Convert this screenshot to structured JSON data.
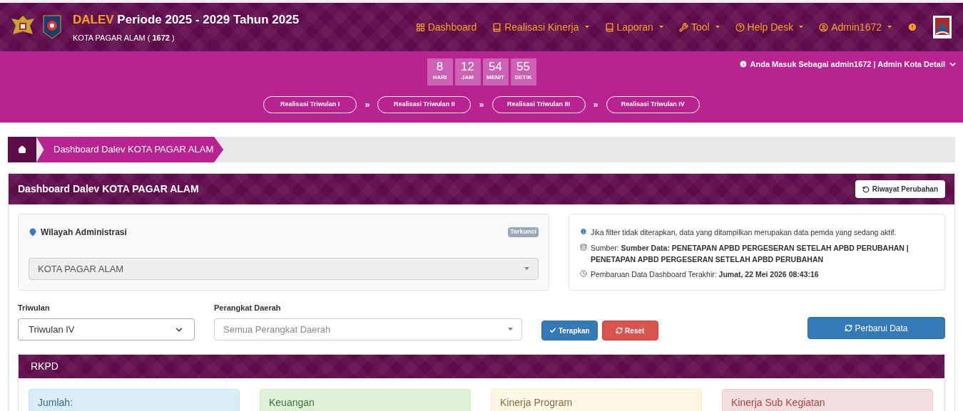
{
  "header": {
    "brand": "DALEV",
    "title": "Periode 2025 - 2029 Tahun 2025",
    "subtitle_name": "KOTA PAGAR ALAM (",
    "subtitle_code": "1672",
    "subtitle_end": ")"
  },
  "nav": [
    {
      "label": "Dashboard",
      "dropdown": false
    },
    {
      "label": "Realisasi Kinerja",
      "dropdown": true
    },
    {
      "label": "Laporan",
      "dropdown": true
    },
    {
      "label": "Tool",
      "dropdown": true
    },
    {
      "label": "Help Desk",
      "dropdown": true
    },
    {
      "label": "Admin1672",
      "dropdown": true
    }
  ],
  "countdown": [
    {
      "value": "8",
      "unit": "HARI"
    },
    {
      "value": "12",
      "unit": "JAM"
    },
    {
      "value": "54",
      "unit": "MENIT"
    },
    {
      "value": "55",
      "unit": "DETIK"
    }
  ],
  "steps": [
    {
      "label": "Realisasi Triwulan I"
    },
    {
      "label": "Realisasi Triwulan II"
    },
    {
      "label": "Realisasi Triwulan III"
    },
    {
      "label": "Realisasi Triwulan IV"
    }
  ],
  "step_separator": "»",
  "user_info": "Anda Masuk Sebagai admin1672 | Admin Kota Detail",
  "breadcrumb": "Dashboard Dalev KOTA PAGAR ALAM",
  "panel": {
    "title": "Dashboard Dalev KOTA PAGAR ALAM",
    "history_button": "Riwayat Perubahan",
    "region": {
      "label": "Wilayah Administrasi",
      "badge": "Terkunci",
      "value": "KOTA PAGAR ALAM"
    },
    "info": {
      "note": "Jika filter tidak diterapkan, data yang ditampilkan merupakan data pemda yang sedang aktif.",
      "source_label": "Sumber:",
      "source_value": "Sumber Data: PENETAPAN APBD PERGESERAN SETELAH APBD PERUBAHAN | PENETAPAN APBD PERGESERAN SETELAH APBD PERUBAHAN",
      "updated_label": "Pembaruan Data Dashboard Terakhir:",
      "updated_value": "Jumat, 22 Mei 2026 08:43:16"
    },
    "filters": {
      "quarter_label": "Triwulan",
      "quarter_value": "Triwulan IV",
      "unit_label": "Perangkat Daerah",
      "unit_placeholder": "Semua Perangkat Daerah",
      "apply": "Terapkan",
      "reset": "Reset",
      "refresh": "Perbarui Data"
    },
    "rkpd": {
      "title": "RKPD",
      "cards": [
        {
          "label": "Jumlah:",
          "kind": "info"
        },
        {
          "label": "Keuangan",
          "kind": "success"
        },
        {
          "label": "Kinerja Program",
          "kind": "warning"
        },
        {
          "label": "Kinerja Sub Kegiatan",
          "kind": "danger"
        }
      ]
    }
  }
}
